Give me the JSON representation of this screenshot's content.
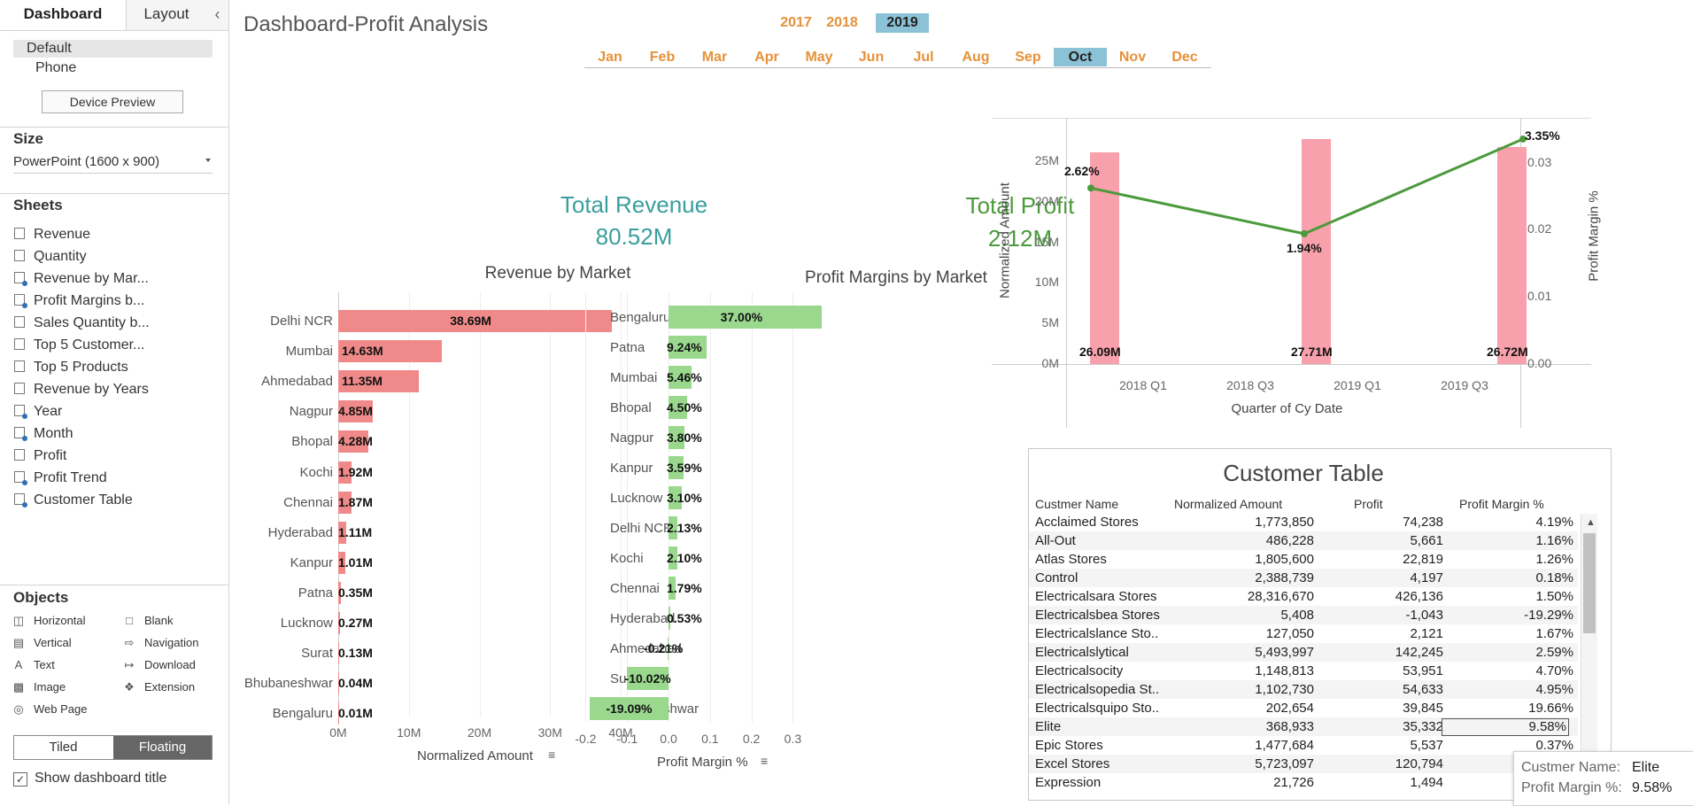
{
  "left_panel": {
    "tabs": [
      "Dashboard",
      "Layout"
    ],
    "device": {
      "default": "Default",
      "phone": "Phone",
      "preview_button": "Device Preview"
    },
    "size": {
      "title": "Size",
      "value": "PowerPoint (1600 x 900)"
    },
    "sheets": {
      "title": "Sheets",
      "items": [
        "Revenue",
        "Quantity",
        "Revenue by Mar...",
        "Profit Margins b...",
        "Sales Quantity b...",
        "Top 5 Customer...",
        "Top 5 Products",
        "Revenue by Years",
        "Year",
        "Month",
        "Profit",
        "Profit Trend",
        "Customer Table"
      ]
    },
    "objects": {
      "title": "Objects",
      "items": [
        {
          "label": "Horizontal",
          "icon": "horizontal-icon"
        },
        {
          "label": "Blank",
          "icon": "blank-icon"
        },
        {
          "label": "Vertical",
          "icon": "vertical-icon"
        },
        {
          "label": "Navigation",
          "icon": "navigation-icon"
        },
        {
          "label": "Text",
          "icon": "text-icon"
        },
        {
          "label": "Download",
          "icon": "download-icon"
        },
        {
          "label": "Image",
          "icon": "image-icon"
        },
        {
          "label": "Extension",
          "icon": "extension-icon"
        },
        {
          "label": "Web Page",
          "icon": "web-page-icon"
        }
      ]
    },
    "layout_toggle": {
      "tiled": "Tiled",
      "floating": "Floating"
    },
    "show_title": "Show dashboard title",
    "collapse_glyph": "‹"
  },
  "dashboard": {
    "title": "Dashboard-Profit Analysis",
    "years": [
      "2017",
      "2018",
      "2019"
    ],
    "selected_year": "2019",
    "months": [
      "Jan",
      "Feb",
      "Mar",
      "Apr",
      "May",
      "Jun",
      "Jul",
      "Aug",
      "Sep",
      "Oct",
      "Nov",
      "Dec"
    ],
    "selected_month": "Oct",
    "kpi_revenue": {
      "title": "Total Revenue",
      "value": "80.52M",
      "color": "#3a9e9e"
    },
    "kpi_profit": {
      "title": "Total Profit",
      "value": "2.12M",
      "color": "#4c9a3d"
    },
    "colors": {
      "revenue_bar": "#f08a8a",
      "profit_bar": "#9ad88e",
      "trend_bar": "#f8a0ab",
      "trend_line": "#4c9a3d",
      "accent_orange": "#e69138",
      "selected": "#8cc2d6"
    }
  },
  "revenue_chart": {
    "chart_data": {
      "type": "bar",
      "title": "Revenue by Market",
      "xlabel": "Normalized Amount",
      "ylabel": "",
      "categories": [
        "Delhi NCR",
        "Mumbai",
        "Ahmedabad",
        "Nagpur",
        "Bhopal",
        "Kochi",
        "Chennai",
        "Hyderabad",
        "Kanpur",
        "Patna",
        "Lucknow",
        "Surat",
        "Bhubaneshwar",
        "Bengaluru"
      ],
      "values": [
        38.69,
        14.63,
        11.35,
        4.85,
        4.28,
        1.92,
        1.87,
        1.11,
        1.01,
        0.35,
        0.27,
        0.13,
        0.04,
        0.01
      ],
      "labels": [
        "38.69M",
        "14.63M",
        "11.35M",
        "4.85M",
        "4.28M",
        "1.92M",
        "1.87M",
        "1.11M",
        "1.01M",
        "0.35M",
        "0.27M",
        "0.13M",
        "0.04M",
        "0.01M"
      ],
      "xlim": [
        0,
        40
      ],
      "ticks": [
        "0M",
        "10M",
        "20M",
        "30M",
        "40M"
      ],
      "tick_values": [
        0,
        10,
        20,
        30,
        40
      ]
    },
    "sort_icon": "sort-icon"
  },
  "profit_chart": {
    "chart_data": {
      "type": "bar",
      "title": "Profit Margins by Market",
      "xlabel": "Profit Margin %",
      "ylabel": "",
      "categories": [
        "Bengaluru",
        "Patna",
        "Mumbai",
        "Bhopal",
        "Nagpur",
        "Kanpur",
        "Lucknow",
        "Delhi NCR",
        "Kochi",
        "Chennai",
        "Hyderabad",
        "Ahmedabad",
        "Surat",
        "Bhubaneshwar"
      ],
      "values": [
        0.37,
        0.0924,
        0.0546,
        0.045,
        0.038,
        0.0359,
        0.031,
        0.0213,
        0.021,
        0.0179,
        0.0053,
        -0.0021,
        -0.1002,
        -0.1909
      ],
      "labels": [
        "37.00%",
        "9.24%",
        "5.46%",
        "4.50%",
        "3.80%",
        "3.59%",
        "3.10%",
        "2.13%",
        "2.10%",
        "1.79%",
        "0.53%",
        "-0.21%",
        "-10.02%",
        "-19.09%"
      ],
      "xlim": [
        -0.2,
        0.37
      ],
      "ticks": [
        "-0.2",
        "-0.1",
        "0.0",
        "0.1",
        "0.2",
        "0.3"
      ],
      "tick_values": [
        -0.2,
        -0.1,
        0.0,
        0.1,
        0.2,
        0.3
      ]
    },
    "sort_icon": "sort-icon"
  },
  "trend_chart": {
    "chart_data": {
      "type": "bar",
      "title": "",
      "xlabel": "Quarter of Cy Date",
      "ylabel": "Normalized Amount",
      "y2label": "Profit Margin %",
      "x_ticks": [
        "2018 Q1",
        "2018 Q3",
        "2019 Q1",
        "2019 Q3"
      ],
      "series": [
        {
          "name": "Normalized Amount",
          "x": [
            "2017 Q4",
            "2018 Q4",
            "2019 Q4"
          ],
          "values": [
            26.09,
            27.71,
            26.72
          ],
          "labels": [
            "26.09M",
            "27.71M",
            "26.72M"
          ]
        },
        {
          "name": "Profit Margin %",
          "x": [
            "2017 Q4",
            "2018 Q4",
            "2019 Q4"
          ],
          "values": [
            0.0262,
            0.0194,
            0.0335
          ],
          "labels": [
            "2.62%",
            "1.94%",
            "3.35%"
          ]
        }
      ],
      "ylim": [
        0,
        27.71
      ],
      "y_ticks": [
        "0M",
        "5M",
        "10M",
        "15M",
        "20M",
        "25M"
      ],
      "y_tick_values": [
        0,
        5,
        10,
        15,
        20,
        25
      ],
      "y2lim": [
        0,
        0.0335
      ],
      "y2_ticks": [
        "0.00",
        "0.01",
        "0.02",
        "0.03"
      ],
      "y2_tick_values": [
        0,
        0.01,
        0.02,
        0.03
      ]
    }
  },
  "customer_table": {
    "title": "Customer Table",
    "columns": [
      "Custmer Name",
      "Normalized Amount",
      "Profit",
      "Profit Margin %"
    ],
    "rows": [
      [
        "Acclaimed Stores",
        "1,773,850",
        "74,238",
        "4.19%"
      ],
      [
        "All-Out",
        "486,228",
        "5,661",
        "1.16%"
      ],
      [
        "Atlas Stores",
        "1,805,600",
        "22,819",
        "1.26%"
      ],
      [
        "Control",
        "2,388,739",
        "4,197",
        "0.18%"
      ],
      [
        "Electricalsara Stores",
        "28,316,670",
        "426,136",
        "1.50%"
      ],
      [
        "Electricalsbea Stores",
        "5,408",
        "-1,043",
        "-19.29%"
      ],
      [
        "Electricalslance Sto..",
        "127,050",
        "2,121",
        "1.67%"
      ],
      [
        "Electricalslytical",
        "5,493,997",
        "142,245",
        "2.59%"
      ],
      [
        "Electricalsocity",
        "1,148,813",
        "53,951",
        "4.70%"
      ],
      [
        "Electricalsopedia St..",
        "1,102,730",
        "54,633",
        "4.95%"
      ],
      [
        "Electricalsquipo Sto..",
        "202,654",
        "39,845",
        "19.66%"
      ],
      [
        "Elite",
        "368,933",
        "35,332",
        "9.58%"
      ],
      [
        "Epic Stores",
        "1,477,684",
        "5,537",
        "0.37%"
      ],
      [
        "Excel Stores",
        "5,723,097",
        "120,794",
        "2.11%"
      ],
      [
        "Expression",
        "21,726",
        "1,494",
        ""
      ]
    ],
    "selected_row": 11
  },
  "tooltip": {
    "name_label": "Custmer Name:",
    "name_value": "Elite",
    "margin_label": "Profit Margin %:",
    "margin_value": "9.58%"
  }
}
